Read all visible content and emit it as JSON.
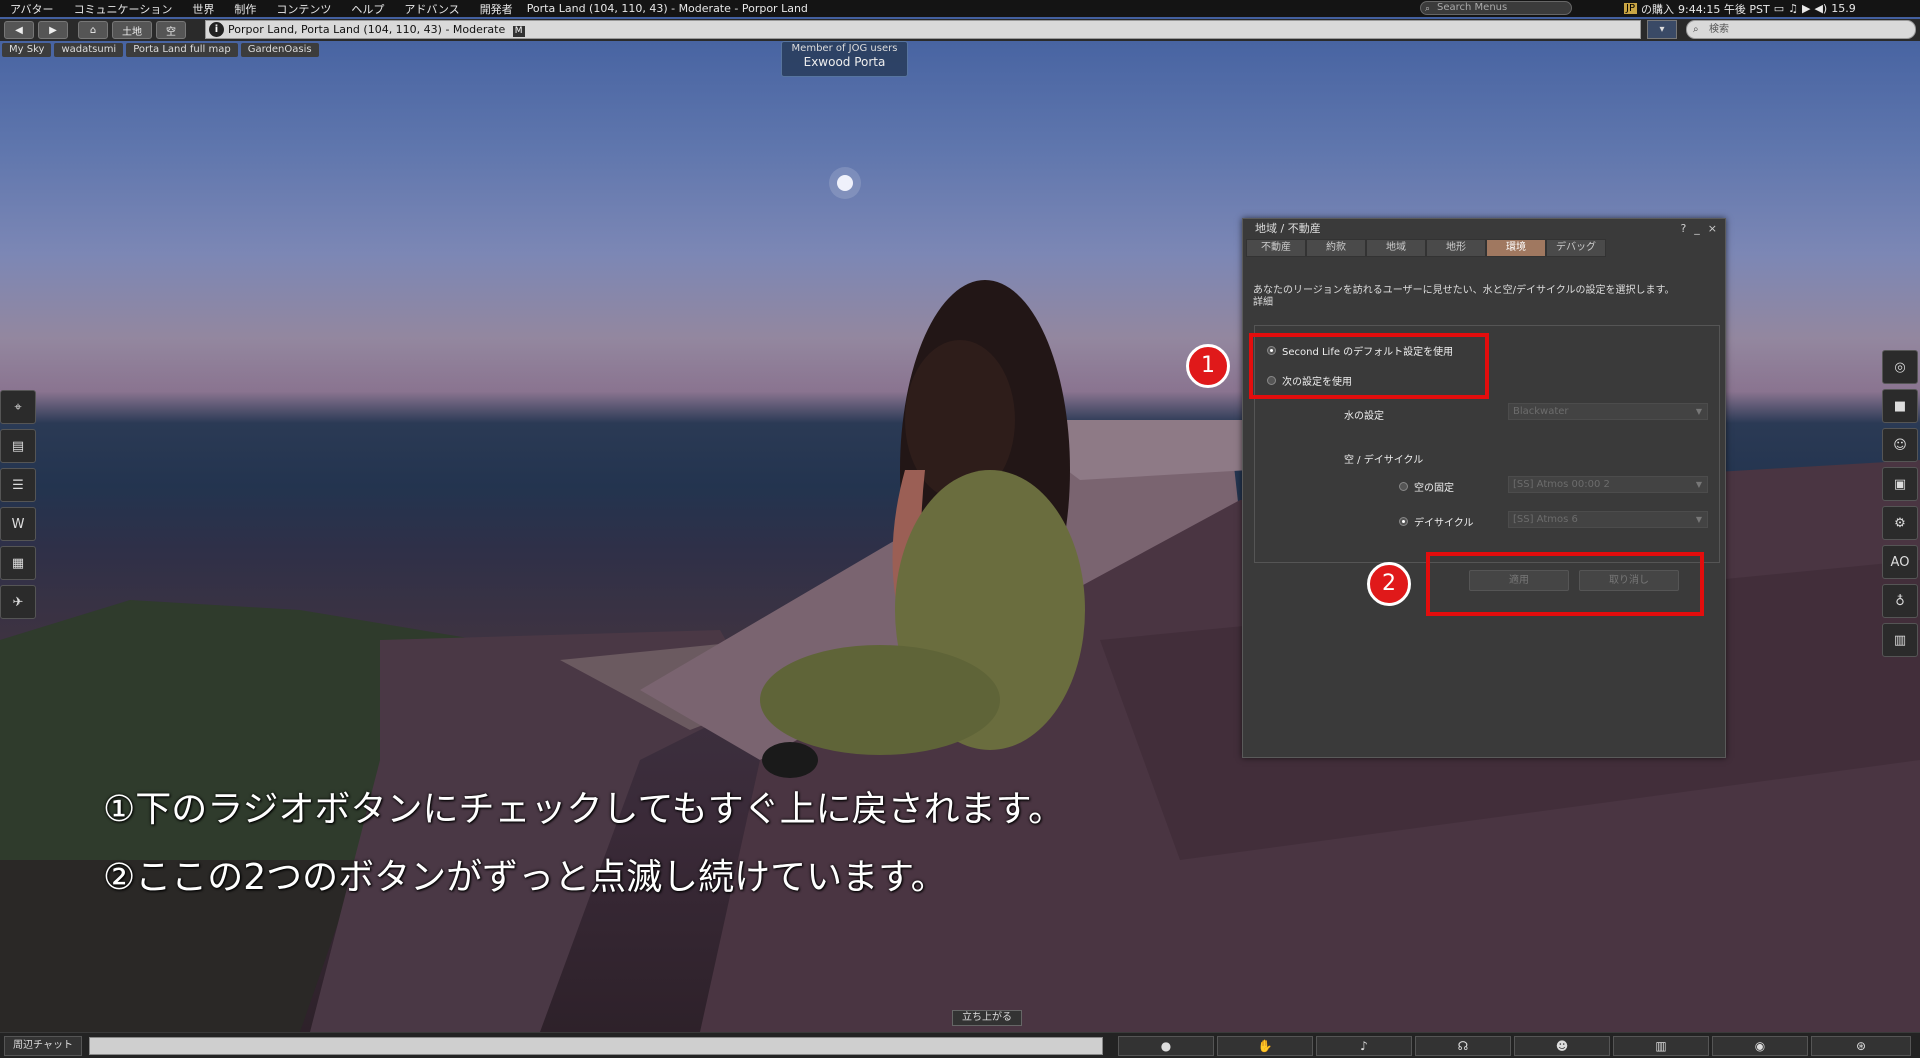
{
  "menubar": {
    "items": [
      "アバター",
      "コミュニケーション",
      "世界",
      "制作",
      "コンテンツ",
      "ヘルプ",
      "アドバンス",
      "開発者"
    ],
    "location": "Porta Land (104, 110, 43) - Moderate - Porpor Land",
    "search_placeholder": "Search Menus",
    "lang_badge": "JP",
    "purchase_label": "の購入",
    "clock": "9:44:15 午後 PST",
    "status_value": "15.9"
  },
  "navbar": {
    "back_icon": "◀",
    "forward_icon": "▶",
    "home_icon": "⌂",
    "land_button": "土地",
    "sky_button": "空",
    "url_text": "Porpor Land, Porta Land (104, 110, 43) - Moderate",
    "url_badge": "M",
    "info_icon": "i",
    "search_placeholder": "検索"
  },
  "favorites": [
    "My Sky",
    "wadatsumi",
    "Porta Land full map",
    "GardenOasis"
  ],
  "nametag": {
    "group": "Member of JOG users",
    "name": "Exwood Porta"
  },
  "sidebar_left": [
    "location-pin-icon",
    "profile-card-icon",
    "notes-icon",
    "www-icon",
    "map-icon",
    "teleport-icon"
  ],
  "sidebar_right": [
    "snapshot-icon",
    "camera-icon",
    "avatar-icon",
    "landmark-icon",
    "movement-icon",
    "ao-icon",
    "appearance-icon",
    "inventory-icon"
  ],
  "sidebar_right_ao_label": "AO",
  "floater": {
    "title": "地域 / 不動産",
    "help_icon": "?",
    "minimize_icon": "_",
    "close_icon": "×",
    "tabs": [
      "不動産",
      "約款",
      "地域",
      "地形",
      "環境",
      "デバッグ"
    ],
    "active_tab": "環境",
    "description": "あなたのリージョンを訪れるユーザーに見せたい、水と空/デイサイクルの設定を選択します。",
    "details_link": "詳細",
    "radio_default": "Second Life のデフォルト設定を使用",
    "radio_custom": "次の設定を使用",
    "water_label": "水の設定",
    "water_value": "Blackwater",
    "sky_label": "空 / デイサイクル",
    "sky_fixed_label": "空の固定",
    "sky_fixed_value": "[SS] Atmos 00:00 2",
    "daycycle_label": "デイサイクル",
    "daycycle_value": "[SS] Atmos 6",
    "apply_button": "適用",
    "cancel_button": "取り消し"
  },
  "annotations": {
    "callout1": "1",
    "callout2": "2",
    "caption1": "①下のラジオボタンにチェックしてもすぐ上に戻されます。",
    "caption2": "②ここの2つのボタンがずっと点滅し続けています。",
    "highlight_color": "#e30d0d"
  },
  "stand_up": "立ち上がる",
  "bottombar": {
    "chat_button": "周辺チャット",
    "buttons": [
      "chat-bubble-icon",
      "gesture-icon",
      "microphone-icon",
      "headset-icon",
      "people-icon",
      "map-icon",
      "radar-icon",
      "destinations-icon"
    ]
  }
}
